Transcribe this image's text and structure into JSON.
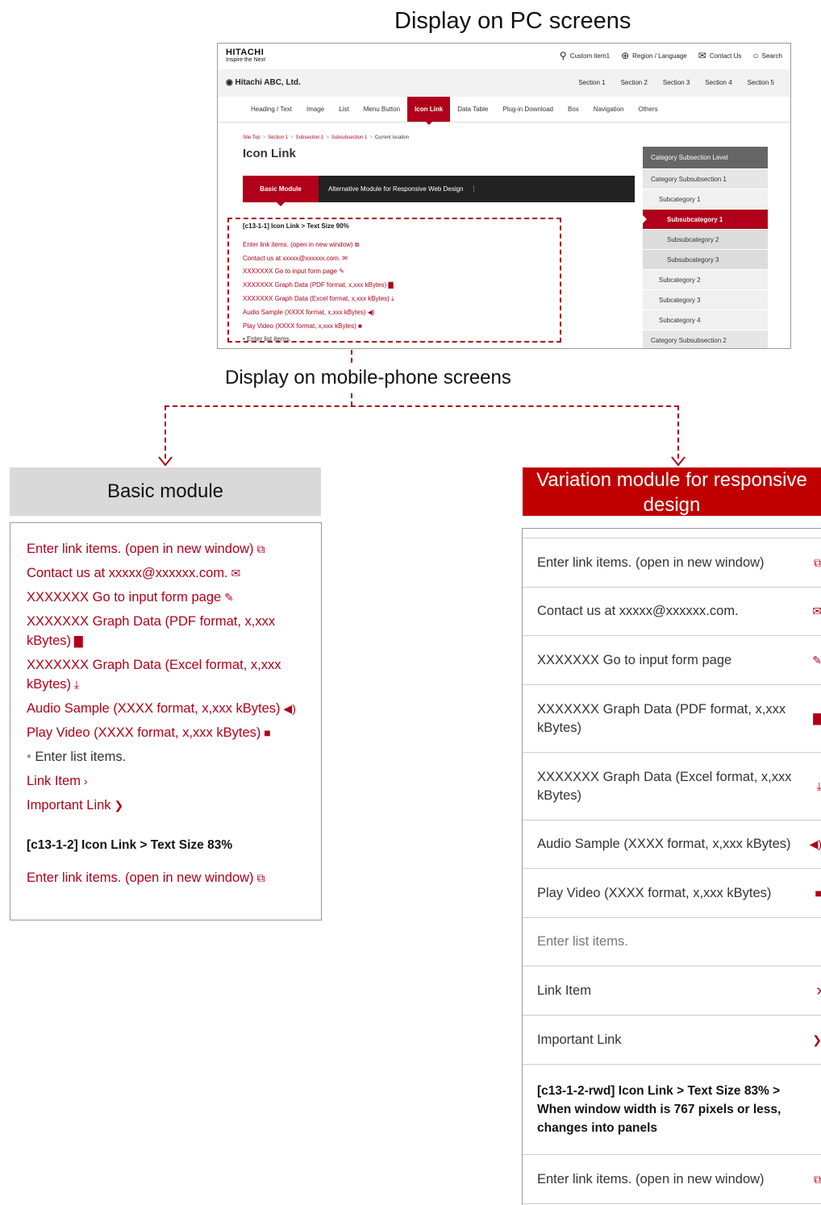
{
  "titles": {
    "pc": "Display on PC screens",
    "mobile": "Display on mobile-phone screens",
    "basic": "Basic module",
    "variation": "Variation module for responsive design"
  },
  "pc": {
    "logo": "HITACHI",
    "tagline": "Inspire the Next",
    "util": [
      "Custom item1",
      "Region / Language",
      "Contact Us",
      "Search"
    ],
    "site_name": "Hitachi ABC, Ltd.",
    "sections": [
      "Section 1",
      "Section 2",
      "Section 3",
      "Section 4",
      "Section 5"
    ],
    "gnav": [
      "Heading / Text",
      "Image",
      "List",
      "Menu Button",
      "Icon Link",
      "Data Table",
      "Plug-in Download",
      "Box",
      "Navigation",
      "Others"
    ],
    "gnav_active": "Icon Link",
    "breadcrumb": [
      "Site Top",
      "Section 1",
      "Subsection 1",
      "Subsubsection 1",
      "Current location"
    ],
    "page_title": "Icon Link",
    "tabs": [
      "Basic Module",
      "Alternative Module for Responsive Web Design"
    ],
    "module_heading": "[c13-1-1] Icon Link > Text Size 90%",
    "links": [
      "Enter link items. (open in new window)",
      "Contact us at xxxxx@xxxxxx.com.",
      "XXXXXXX Go to input form page",
      "XXXXXXX Graph Data (PDF format, x,xxx kBytes)",
      "XXXXXXX Graph Data (Excel format, x,xxx kBytes)",
      "Audio Sample (XXXX format, x,xxx kBytes)",
      "Play Video (XXXX format, x,xxx kBytes)"
    ],
    "list_item": "Enter list items.",
    "sidebar": [
      "Category Subsection Level",
      "Category Subsubsection 1",
      "Subcategory 1",
      "Subsubcategory 1",
      "Subsubcategory 2",
      "Subsubcategory 3",
      "Subcategory 2",
      "Subcategory 3",
      "Subcategory 4",
      "Category Subsubsection 2"
    ]
  },
  "basic": {
    "links": [
      "Enter link items. (open in new window)",
      "Contact us at xxxxx@xxxxxx.com.",
      "XXXXXXX Go to input form page",
      "XXXXXXX Graph Data (PDF format, x,xxx kBytes)",
      "XXXXXXX Graph Data (Excel format, x,xxx kBytes)",
      "Audio Sample (XXXX format, x,xxx kBytes)",
      "Play Video (XXXX format, x,xxx kBytes)"
    ],
    "list_item": "Enter list items.",
    "link_item": "Link Item",
    "important_link": "Important Link",
    "heading2": "[c13-1-2] Icon Link > Text Size 83%",
    "link_after": "Enter link items. (open in new window)"
  },
  "variation": {
    "rows": [
      "Enter link items. (open in new window)",
      "Contact us at xxxxx@xxxxxx.com.",
      "XXXXXXX Go to input form page",
      "XXXXXXX Graph Data (PDF format, x,xxx kBytes)",
      "XXXXXXX Graph Data (Excel format, x,xxx kBytes)",
      "Audio Sample (XXXX format, x,xxx kBytes)",
      "Play Video (XXXX format, x,xxx kBytes)",
      "Enter list items.",
      "Link Item",
      "Important Link"
    ],
    "heading2": "[c13-1-2-rwd] Icon Link > Text Size 83% > When window width is 767 pixels or less, changes into panels",
    "link_after": "Enter link items. (open in new window)"
  },
  "colors": {
    "accent": "#b0001a",
    "variation_head": "#c00000",
    "basic_head": "#d9d9d9"
  }
}
